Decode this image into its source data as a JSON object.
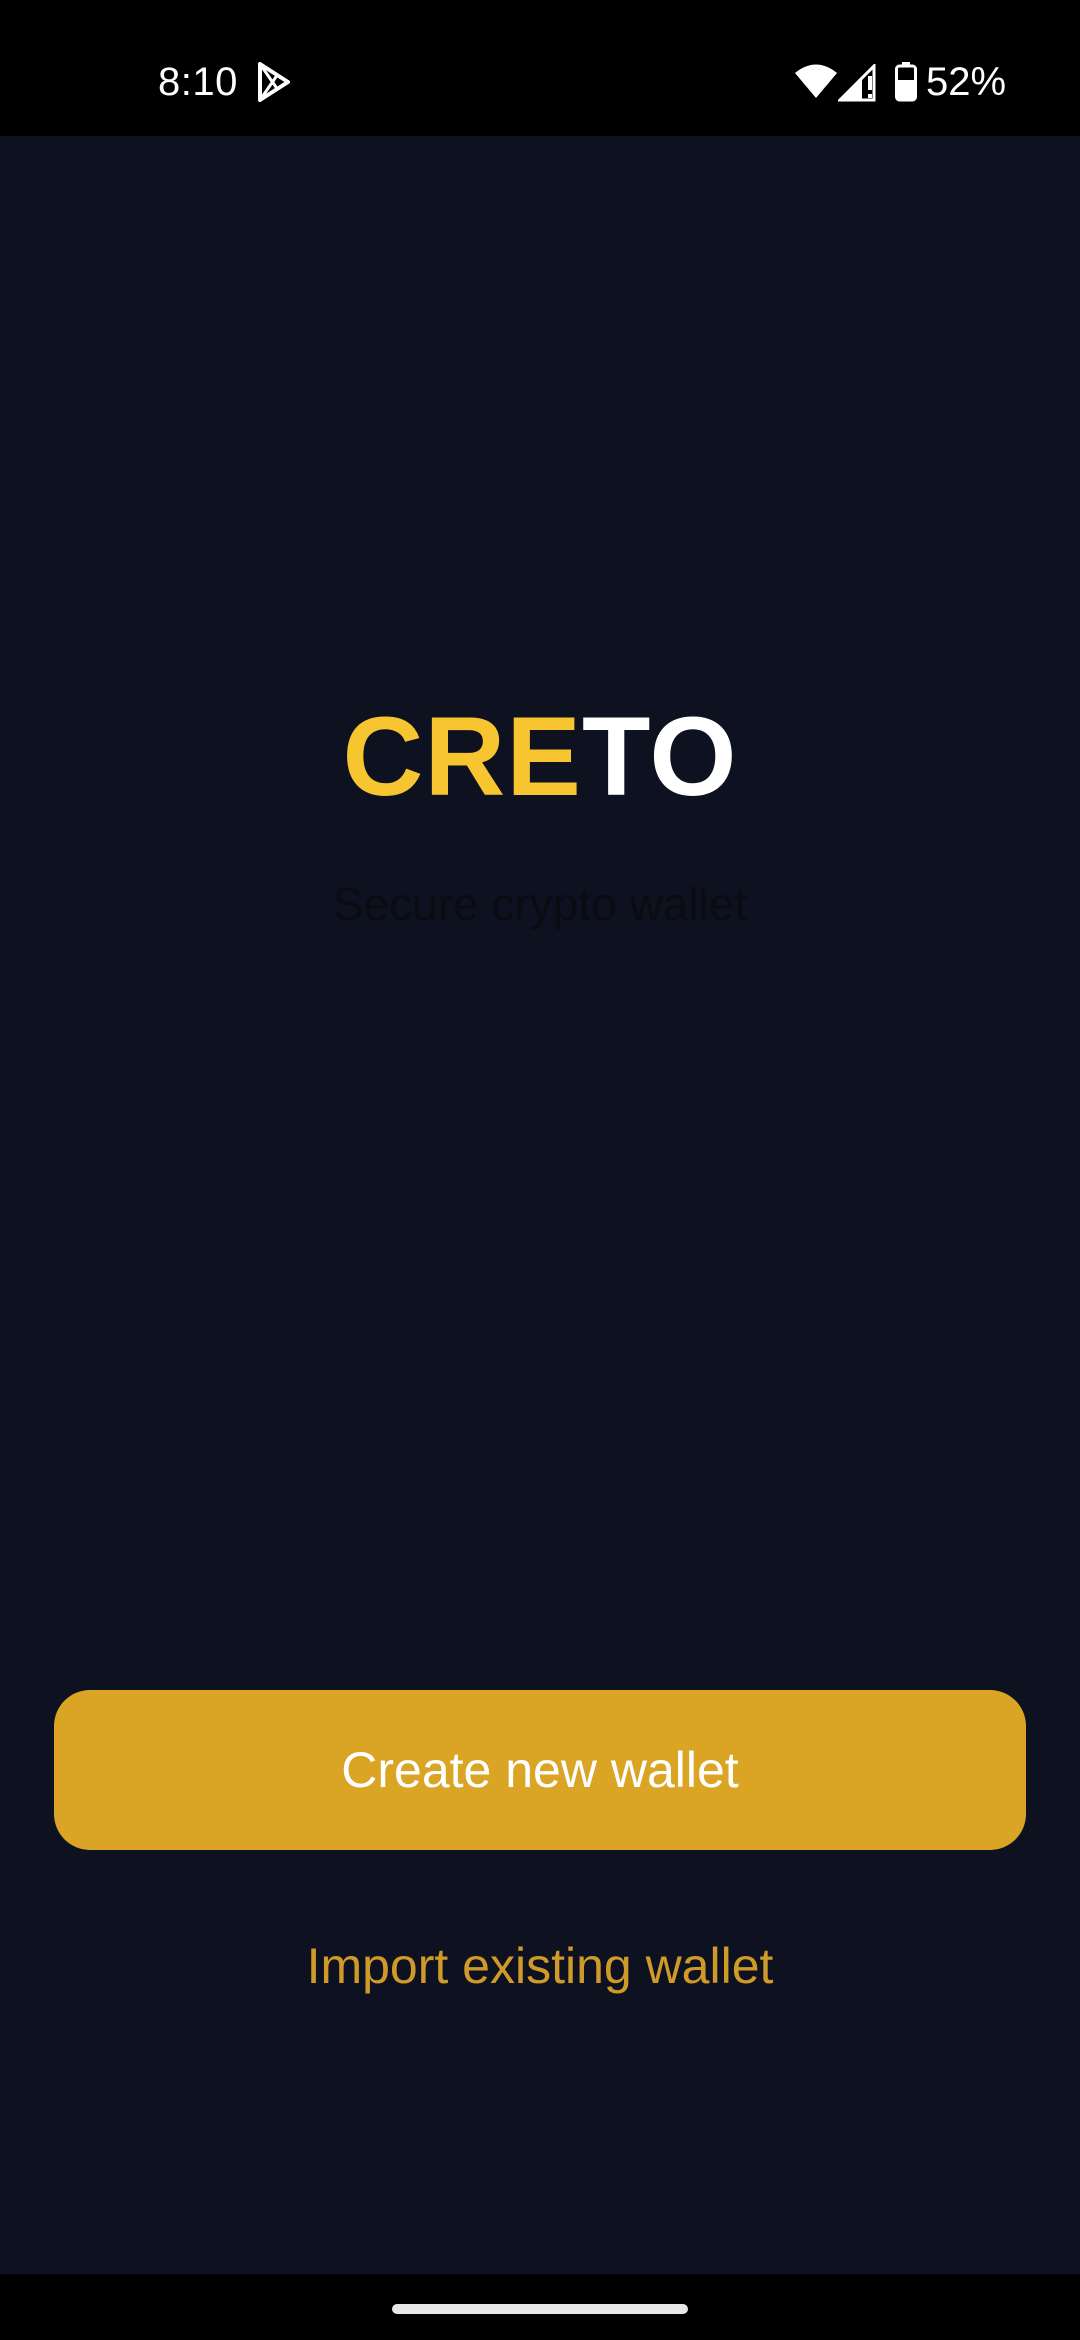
{
  "status_bar": {
    "time": "8:10",
    "battery": "52%",
    "icons": [
      "play-store-icon",
      "wifi-icon",
      "signal-icon",
      "battery-icon"
    ]
  },
  "logo": {
    "part_accent": "CRE",
    "part_rest": "TO"
  },
  "tagline": "Secure crypto wallet",
  "actions": {
    "create_label": "Create new wallet",
    "import_label": "Import existing wallet"
  },
  "colors": {
    "background": "#0d1120",
    "accent_yellow": "#f7c52f",
    "button": "#daa425",
    "link": "#cf9a27"
  }
}
